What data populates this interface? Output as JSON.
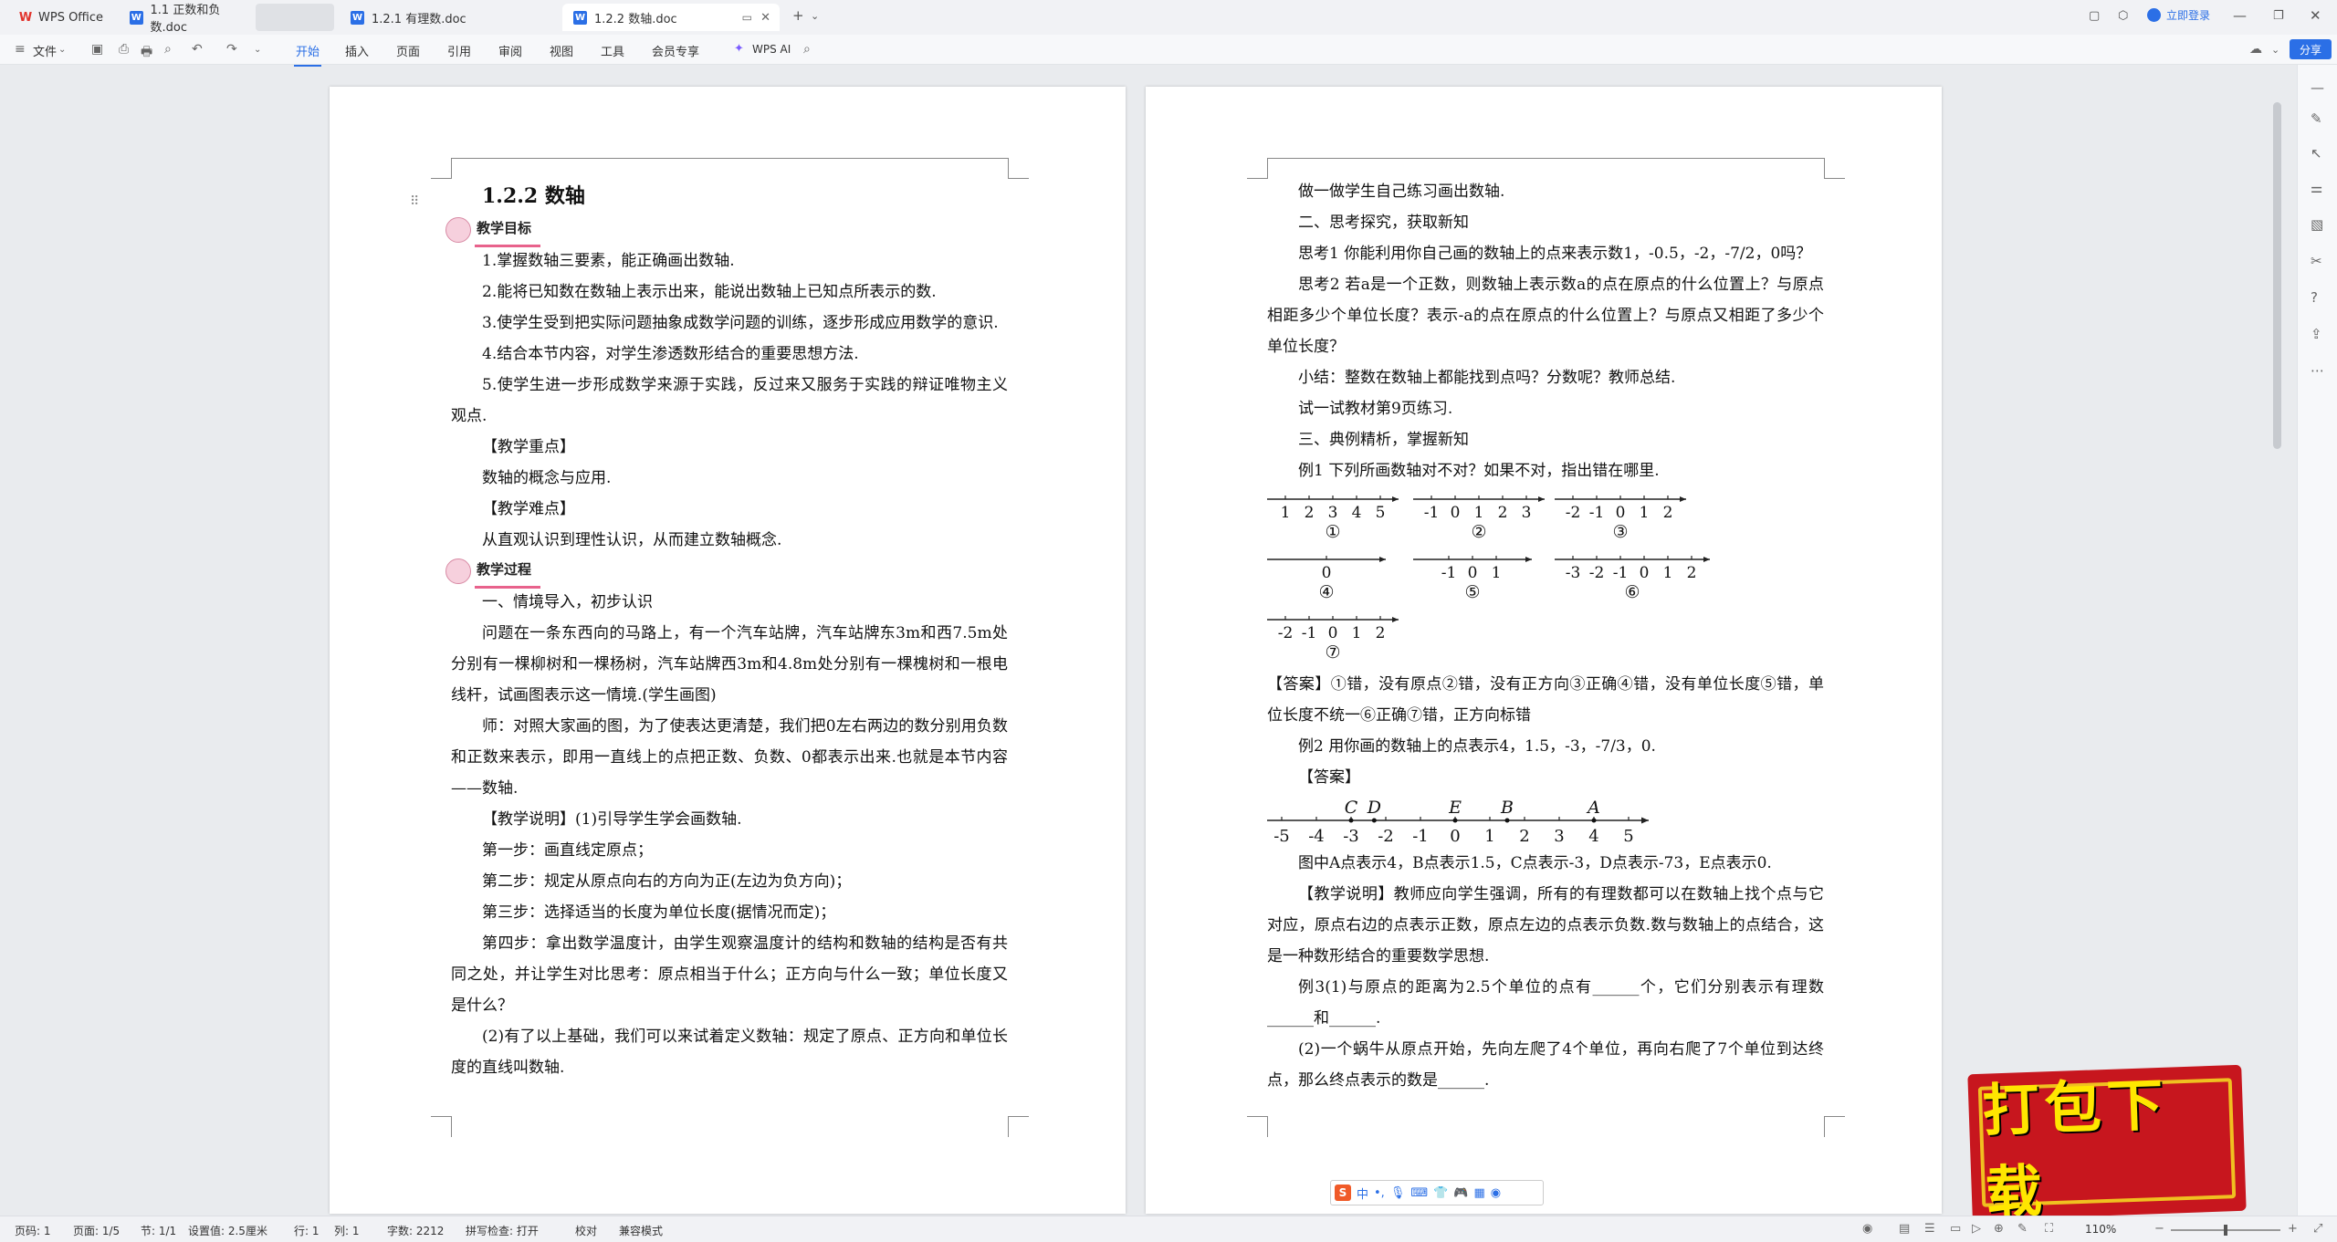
{
  "app": {
    "tabs": [
      {
        "label": "WPS Office"
      },
      {
        "label": "1.1 正数和负数.doc"
      },
      {
        "label": ""
      },
      {
        "label": "1.2.1 有理数.doc"
      },
      {
        "label": "1.2.2 数轴.doc"
      }
    ],
    "login_label": "立即登录"
  },
  "toolbar": {
    "file_label": "文件",
    "menus": [
      "开始",
      "插入",
      "页面",
      "引用",
      "审阅",
      "视图",
      "工具",
      "会员专享"
    ],
    "wps_ai_label": "WPS AI",
    "share_label": "分享"
  },
  "page1": {
    "title": "1.2.2 数轴",
    "section1_label": "教学目标",
    "goals": [
      "1.掌握数轴三要素，能正确画出数轴.",
      "2.能将已知数在数轴上表示出来，能说出数轴上已知点所表示的数.",
      "3.使学生受到把实际问题抽象成数学问题的训练，逐步形成应用数学的意识.",
      "4.结合本节内容，对学生渗透数形结合的重要思想方法.",
      "5.使学生进一步形成数学来源于实践，反过来又服务于实践的辩证唯物主义观点."
    ],
    "key_point_label": "【教学重点】",
    "key_point": "数轴的概念与应用.",
    "difficulty_label": "【教学难点】",
    "difficulty": "从直观认识到理性认识，从而建立数轴概念.",
    "section2_label": "教学过程",
    "process": [
      "一、情境导入，初步认识",
      "问题在一条东西向的马路上，有一个汽车站牌，汽车站牌东3m和西7.5m处分别有一棵柳树和一棵杨树，汽车站牌西3m和4.8m处分别有一棵槐树和一根电线杆，试画图表示这一情境.(学生画图)",
      "师：对照大家画的图，为了使表达更清楚，我们把0左右两边的数分别用负数和正数来表示，即用一直线上的点把正数、负数、0都表示出来.也就是本节内容——数轴.",
      "【教学说明】(1)引导学生学会画数轴.",
      "第一步：画直线定原点；",
      "第二步：规定从原点向右的方向为正(左边为负方向)；",
      "第三步：选择适当的长度为单位长度(据情况而定)；",
      "第四步：拿出数学温度计，由学生观察温度计的结构和数轴的结构是否有共同之处，并让学生对比思考：原点相当于什么；正方向与什么一致；单位长度又是什么？",
      "(2)有了以上基础，我们可以来试着定义数轴：规定了原点、正方向和单位长度的直线叫数轴."
    ]
  },
  "page2": {
    "paras_top": [
      "做一做学生自己练习画出数轴.",
      "二、思考探究，获取新知",
      "思考1 你能利用你自己画的数轴上的点来表示数1，-0.5，-2，-7/2，0吗？",
      "思考2 若a是一个正数，则数轴上表示数a的点在原点的什么位置上？与原点相距多少个单位长度？表示-a的点在原点的什么位置上？与原点又相距了多少个单位长度？",
      "小结：整数在数轴上都能找到点吗？分数呢？教师总结.",
      "试一试教材第9页练习.",
      "三、典例精析，掌握新知",
      "例1 下列所画数轴对不对？如果不对，指出错在哪里."
    ],
    "figures": [
      {
        "labels": [
          "1",
          "2",
          "3",
          "4",
          "5"
        ],
        "mark": "①"
      },
      {
        "labels": [
          "-1",
          "0",
          "1",
          "2",
          "3"
        ],
        "mark": "②"
      },
      {
        "labels": [
          "-2",
          "-1",
          "0",
          "1",
          "2"
        ],
        "mark": "③"
      },
      {
        "labels": [
          "0"
        ],
        "mark": "④"
      },
      {
        "labels": [
          "-1",
          "0",
          "1"
        ],
        "mark": "⑤"
      },
      {
        "labels": [
          "-3",
          "-2",
          "-1",
          "0",
          "1",
          "2"
        ],
        "mark": "⑥"
      },
      {
        "labels": [
          "-2",
          "-1",
          "0",
          "1",
          "2"
        ],
        "mark": "⑦"
      }
    ],
    "answer1": "【答案】①错，没有原点②错，没有正方向③正确④错，没有单位长度⑤错，单位长度不统一⑥正确⑦错，正方向标错",
    "example2": "例2 用你画的数轴上的点表示4，1.5，-3，-7/3，0.",
    "answer_label": "【答案】",
    "big_axis": {
      "ticks": [
        "-5",
        "-4",
        "-3",
        "-2",
        "-1",
        "0",
        "1",
        "2",
        "3",
        "4",
        "5"
      ],
      "points": [
        "C",
        "D",
        "E",
        "B",
        "A"
      ]
    },
    "paras_bottom": [
      "图中A点表示4，B点表示1.5，C点表示-3，D点表示-73，E点表示0.",
      "【教学说明】教师应向学生强调，所有的有理数都可以在数轴上找个点与它对应，原点右边的点表示正数，原点左边的点表示负数.数与数轴上的点结合，这是一种数形结合的重要数学思想.",
      "例3(1)与原点的距离为2.5个单位的点有______个，它们分别表示有理数______和______.",
      "(2)一个蜗牛从原点开始，先向左爬了4个单位，再向右爬了7个单位到达终点，那么终点表示的数是______."
    ]
  },
  "status": {
    "page_num": "页码: 1",
    "pages": "页面: 1/5",
    "section": "节: 1/1",
    "setting": "设置值: 2.5厘米",
    "row": "行: 1",
    "col": "列: 1",
    "words": "字数: 2212",
    "spell": "拼写检查: 打开",
    "proof": "校对",
    "compat": "兼容模式",
    "zoom": "110%"
  },
  "ime": {
    "label": "中"
  },
  "download_banner": "打包下载"
}
